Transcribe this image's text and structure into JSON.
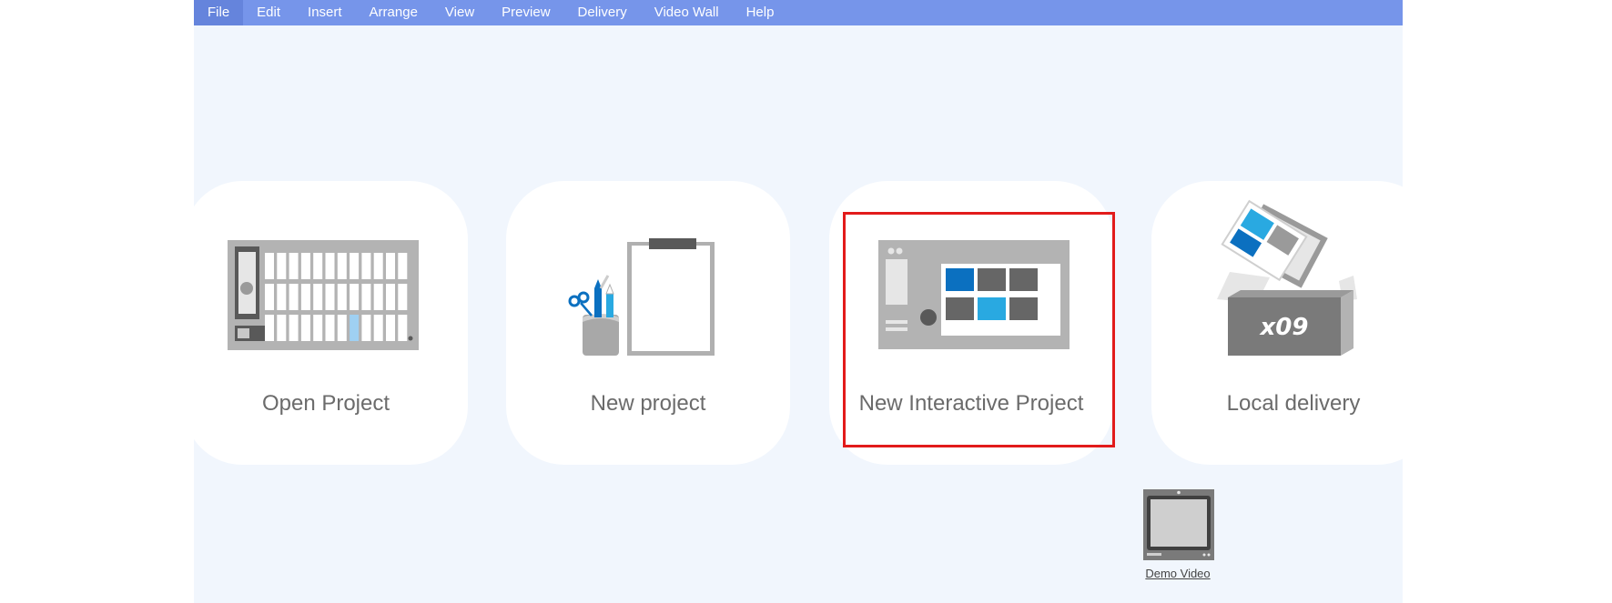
{
  "menu": {
    "items": [
      "File",
      "Edit",
      "Insert",
      "Arrange",
      "View",
      "Preview",
      "Delivery",
      "Video Wall",
      "Help"
    ]
  },
  "cards": {
    "open_project": "Open Project",
    "new_project": "New project",
    "new_interactive_project": "New Interactive Project",
    "local_delivery": "Local delivery"
  },
  "box_label": "x09",
  "demo_video": {
    "label": "Demo Video"
  },
  "colors": {
    "menubar": "#7695ea",
    "background": "#f1f6fd",
    "accent_blue": "#0b70c0",
    "light_blue": "#29a9e1",
    "highlight": "#e21b1b"
  }
}
